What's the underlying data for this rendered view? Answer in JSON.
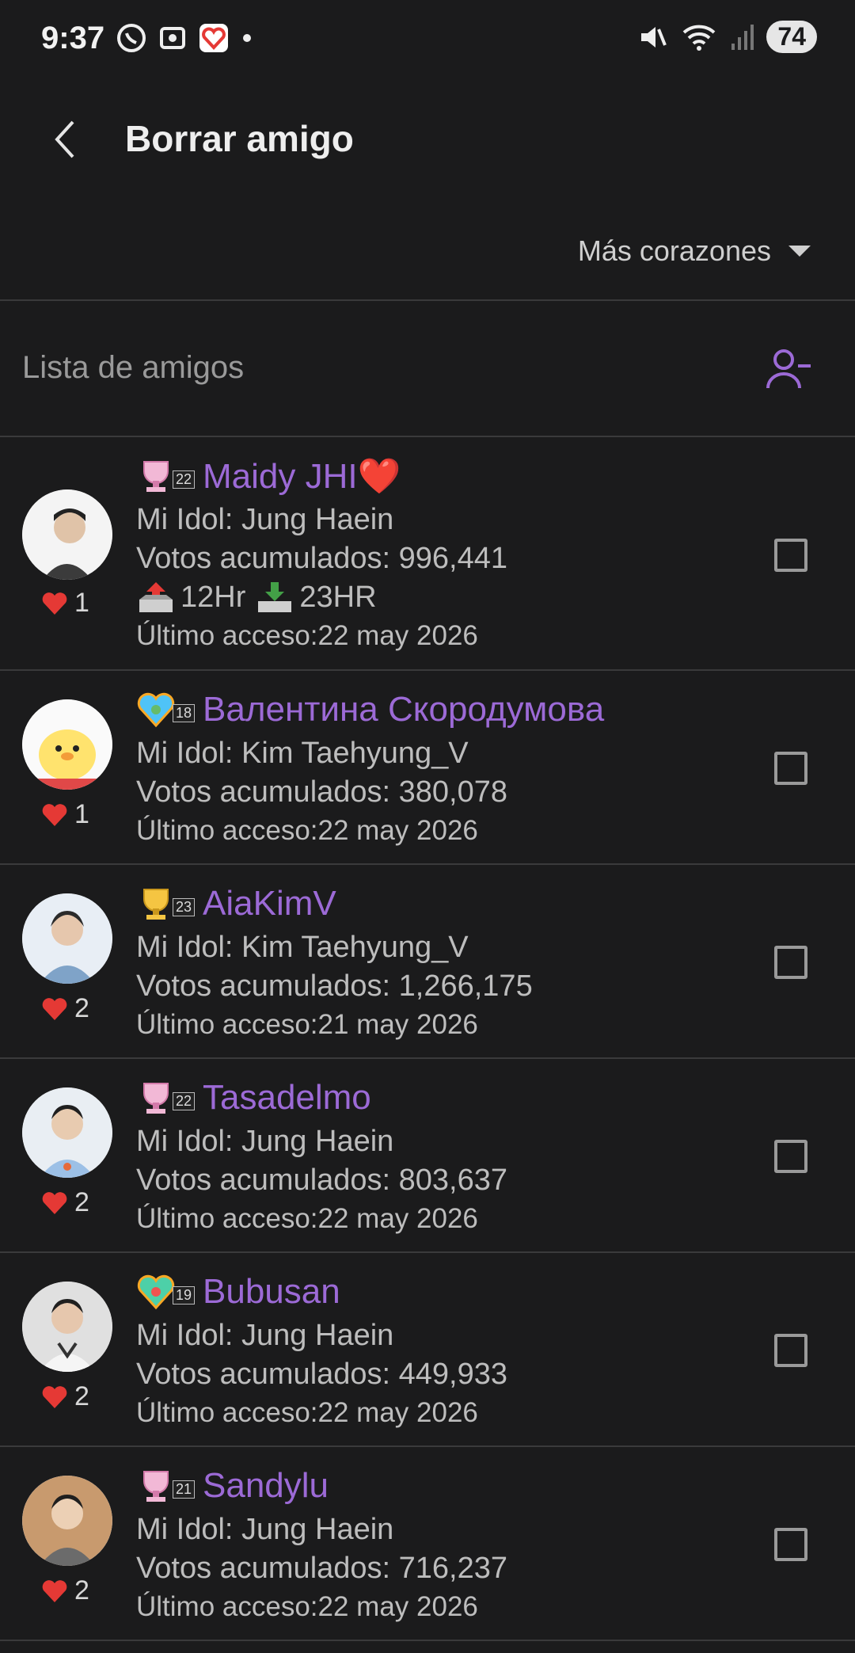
{
  "status_bar": {
    "time": "9:37",
    "battery": "74"
  },
  "header": {
    "title": "Borrar amigo"
  },
  "sort": {
    "label": "Más corazones"
  },
  "list_header": {
    "title": "Lista de amigos"
  },
  "friends": [
    {
      "name": "Maidy JHI❤️",
      "level": "22",
      "idol": "Mi Idol: Jung Haein",
      "votes": "Votos acumulados: 996,441",
      "timers": {
        "send": "12Hr",
        "receive": "23HR"
      },
      "last_access": "Último acceso:22 may 2026",
      "hearts": "1"
    },
    {
      "name": "Валентина Скородумова",
      "level": "18",
      "idol": "Mi Idol: Kim Taehyung_V",
      "votes": "Votos acumulados: 380,078",
      "last_access": "Último acceso:22 may 2026",
      "hearts": "1"
    },
    {
      "name": "AiaKimV",
      "level": "23",
      "idol": "Mi Idol: Kim Taehyung_V",
      "votes": "Votos acumulados: 1,266,175",
      "last_access": "Último acceso:21 may 2026",
      "hearts": "2"
    },
    {
      "name": "Tasadelmo",
      "level": "22",
      "idol": "Mi Idol: Jung Haein",
      "votes": "Votos acumulados: 803,637",
      "last_access": "Último acceso:22 may 2026",
      "hearts": "2"
    },
    {
      "name": "Bubusan",
      "level": "19",
      "idol": "Mi Idol: Jung Haein",
      "votes": "Votos acumulados: 449,933",
      "last_access": "Último acceso:22 may 2026",
      "hearts": "2"
    },
    {
      "name": "Sandylu",
      "level": "21",
      "idol": "Mi Idol: Jung Haein",
      "votes": "Votos acumulados: 716,237",
      "last_access": "Último acceso:22 may 2026",
      "hearts": "2"
    }
  ],
  "colors": {
    "background": "#1b1b1c",
    "accent": "#9c6ad6",
    "heart": "#e53935"
  }
}
